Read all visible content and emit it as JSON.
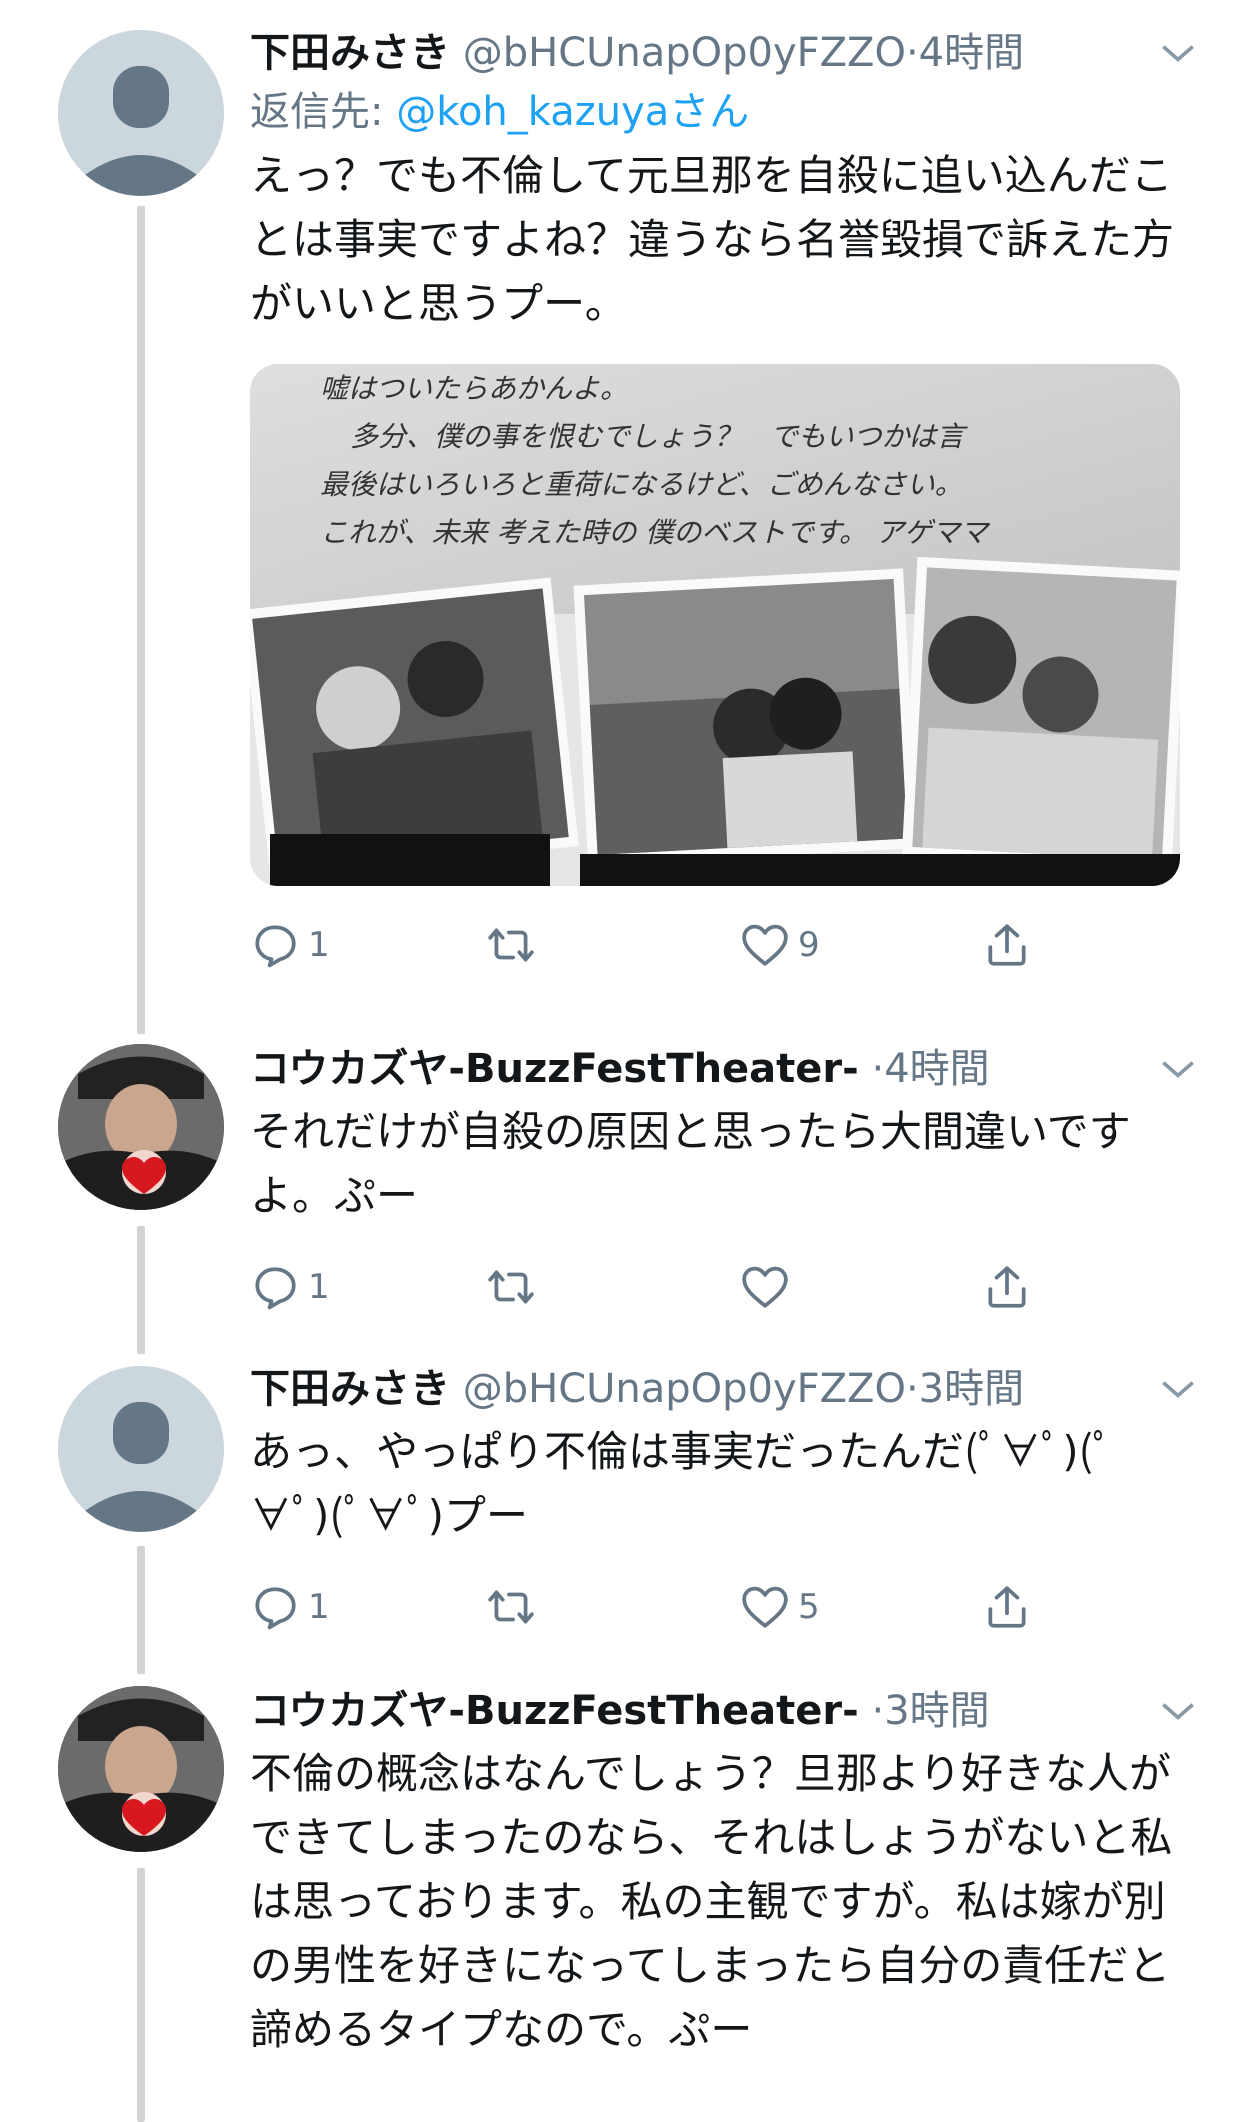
{
  "tweets": [
    {
      "author": "下田みさき",
      "handle": "@bHCUnapOp0yFZZO",
      "sep": "·",
      "time": "4時間",
      "reply_label": "返信先:",
      "reply_user": "@koh_kazuya",
      "reply_suffix": "さん",
      "text": "えっ？でも不倫して元旦那を自殺に追い込んだことは事実ですよね？違うなら名誉毀損で訴えた方がいいと思うプー。",
      "media_text": [
        "嘘はついたらあかんよ。",
        "多分、僕の事を恨むでしょう？　でもいつかは言",
        "最後はいろいろと重荷になるけど、ごめんなさい。",
        "これが、未来 考えた時の 僕のベストです。 アゲママ"
      ],
      "replies": "1",
      "retweets": "",
      "likes": "9",
      "avatar_icon": "default-profile-icon"
    },
    {
      "author": "コウカズヤ-BuzzFestTheater-",
      "handle": "",
      "sep": "·",
      "time": "4時間",
      "text": "それだけが自殺の原因と思ったら大間違いですよ。ぷー",
      "replies": "1",
      "retweets": "",
      "likes": "",
      "avatar_icon": "user-photo"
    },
    {
      "author": "下田みさき",
      "handle": "@bHCUnapOp0yFZZO",
      "sep": "·",
      "time": "3時間",
      "text": "あっ、やっぱり不倫は事実だったんだ(ﾟ∀ﾟ)(ﾟ∀ﾟ)(ﾟ∀ﾟ)プー",
      "replies": "1",
      "retweets": "",
      "likes": "5",
      "avatar_icon": "default-profile-icon"
    },
    {
      "author": "コウカズヤ-BuzzFestTheater-",
      "handle": "",
      "sep": "·",
      "time": "3時間",
      "text": "不倫の概念はなんでしょう？旦那より好きな人ができてしまったのなら、それはしょうがないと私は思っております。私の主観ですが。私は嫁が別の男性を好きになってしまったら自分の責任だと諦めるタイプなので。ぷー",
      "avatar_icon": "user-photo"
    }
  ],
  "colors": {
    "text": "#14171a",
    "secondary": "#657786",
    "link": "#1da1f2",
    "thread": "#d3d3d3"
  }
}
